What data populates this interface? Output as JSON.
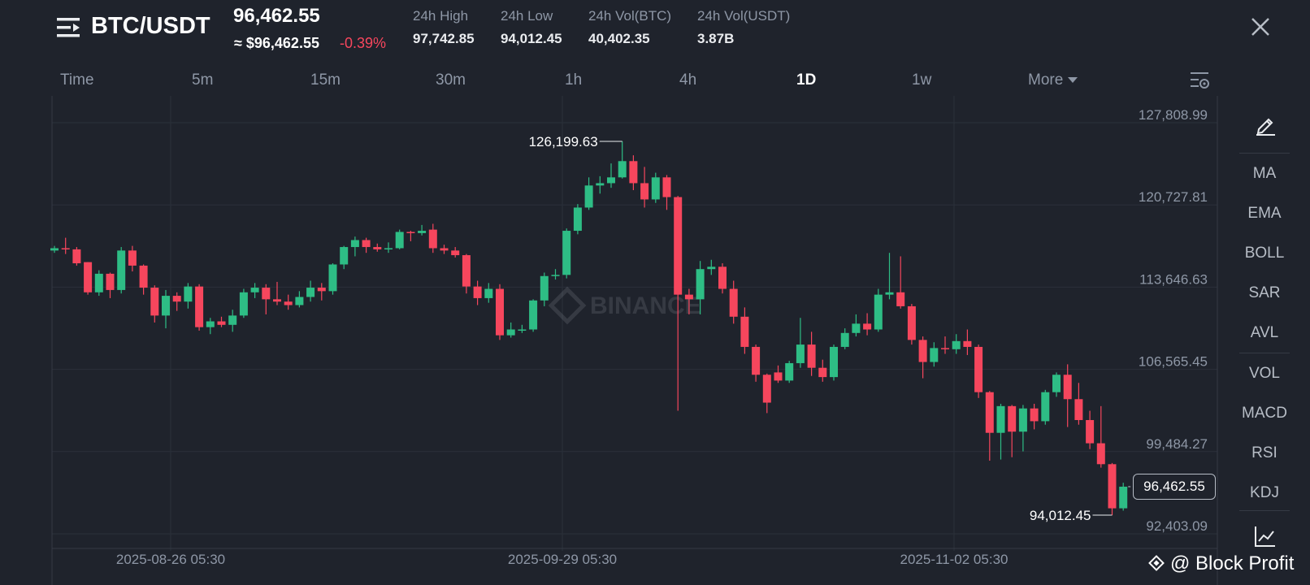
{
  "header": {
    "pair": "BTC/USDT",
    "last_price": "96,462.55",
    "approx_usd": "≈ $96,462.55",
    "change_pct": "-0.39%",
    "stats": [
      {
        "label": "24h High",
        "value": "97,742.85"
      },
      {
        "label": "24h Low",
        "value": "94,012.45"
      },
      {
        "label": "24h Vol(BTC)",
        "value": "40,402.35"
      },
      {
        "label": "24h Vol(USDT)",
        "value": "3.87B"
      }
    ]
  },
  "intervals": [
    "Time",
    "5m",
    "15m",
    "30m",
    "1h",
    "4h",
    "1D",
    "1w"
  ],
  "active_interval": "1D",
  "more_label": "More",
  "indicators": [
    "MA",
    "EMA",
    "BOLL",
    "SAR",
    "AVL",
    "VOL",
    "MACD",
    "RSI",
    "KDJ"
  ],
  "watermark": "BINANCE",
  "attribution": "@ Block Profit",
  "colors": {
    "up": "#2ebd85",
    "down": "#f6465d",
    "bg": "#1f232c",
    "grid": "#2b303a",
    "text_muted": "#8e97a6"
  },
  "chart_data": {
    "type": "candlestick",
    "price_axis_labels": [
      "127,808.99",
      "120,727.81",
      "113,646.63",
      "106,565.45",
      "99,484.27",
      "92,403.09"
    ],
    "price_axis_values": [
      127808.99,
      120727.81,
      113646.63,
      106565.45,
      99484.27,
      92403.09
    ],
    "date_labels": [
      "2025-08-26 05:30",
      "2025-09-29 05:30",
      "2025-11-02 05:30"
    ],
    "high_marker": {
      "label": "126,199.63",
      "value": 126199.63
    },
    "low_marker": {
      "label": "94,012.45",
      "value": 94012.45
    },
    "last_price_label": "96,462.55",
    "last_price_value": 96462.55,
    "candles": [
      [
        116800,
        117000,
        117200,
        116600
      ],
      [
        117000,
        116900,
        117900,
        116500
      ],
      [
        116900,
        115700,
        117100,
        115500
      ],
      [
        115800,
        113200,
        115800,
        113000
      ],
      [
        113200,
        114800,
        115100,
        112900
      ],
      [
        114800,
        113400,
        114900,
        112700
      ],
      [
        113400,
        116800,
        117100,
        113100
      ],
      [
        116800,
        115500,
        117200,
        115000
      ],
      [
        115500,
        113600,
        115600,
        113000
      ],
      [
        113600,
        111200,
        113800,
        110600
      ],
      [
        111200,
        112900,
        113400,
        110100
      ],
      [
        112900,
        112400,
        113200,
        111600
      ],
      [
        112400,
        113700,
        114000,
        111800
      ],
      [
        113700,
        110200,
        113900,
        109900
      ],
      [
        110200,
        110700,
        111000,
        109600
      ],
      [
        110700,
        110400,
        111100,
        110200
      ],
      [
        110400,
        111200,
        111700,
        109800
      ],
      [
        111200,
        113200,
        113500,
        111000
      ],
      [
        113200,
        113600,
        114000,
        112700
      ],
      [
        113600,
        112600,
        113900,
        111300
      ],
      [
        112600,
        112400,
        114100,
        112100
      ],
      [
        112400,
        112100,
        113000,
        111700
      ],
      [
        112100,
        112800,
        113300,
        111900
      ],
      [
        112800,
        113600,
        114200,
        112400
      ],
      [
        113600,
        113300,
        114000,
        112500
      ],
      [
        113300,
        115600,
        115700,
        113000
      ],
      [
        115600,
        117100,
        117200,
        115200
      ],
      [
        117100,
        117700,
        118000,
        116300
      ],
      [
        117700,
        117100,
        117900,
        116600
      ],
      [
        117100,
        116900,
        117400,
        116700
      ],
      [
        116900,
        117000,
        117500,
        116600
      ],
      [
        117000,
        118400,
        118600,
        116900
      ],
      [
        118400,
        118300,
        118500,
        117600
      ],
      [
        118300,
        118500,
        119000,
        118100
      ],
      [
        118600,
        117000,
        119100,
        116600
      ],
      [
        117000,
        116800,
        117300,
        116500
      ],
      [
        116800,
        116400,
        117100,
        116200
      ],
      [
        116400,
        113700,
        116500,
        113100
      ],
      [
        113700,
        112700,
        114200,
        112100
      ],
      [
        112700,
        113500,
        114000,
        112300
      ],
      [
        113500,
        109500,
        113900,
        109100
      ],
      [
        109500,
        110000,
        110600,
        109300
      ],
      [
        110000,
        110000,
        110400,
        109700
      ],
      [
        110000,
        112500,
        112600,
        109800
      ],
      [
        112500,
        114600,
        114900,
        112000
      ],
      [
        114600,
        114700,
        115200,
        114300
      ],
      [
        114700,
        118500,
        118700,
        114400
      ],
      [
        118500,
        120500,
        120800,
        118200
      ],
      [
        120500,
        122400,
        123100,
        120300
      ],
      [
        122400,
        122600,
        123200,
        121700
      ],
      [
        122600,
        123100,
        124300,
        122200
      ],
      [
        123100,
        124500,
        126199.63,
        123000
      ],
      [
        124500,
        122600,
        125000,
        122000
      ],
      [
        122600,
        121200,
        124000,
        120500
      ],
      [
        121200,
        123100,
        123500,
        120900
      ],
      [
        123100,
        121400,
        123300,
        120300
      ],
      [
        121400,
        113000,
        121500,
        103000
      ],
      [
        113000,
        112600,
        113500,
        111300
      ],
      [
        112600,
        115200,
        115900,
        111300
      ],
      [
        115200,
        115400,
        116000,
        114700
      ],
      [
        115400,
        113500,
        115700,
        113100
      ],
      [
        113500,
        111100,
        114200,
        110500
      ],
      [
        111100,
        108500,
        111900,
        107900
      ],
      [
        108500,
        106100,
        108700,
        105500
      ],
      [
        106100,
        103700,
        106200,
        102800
      ],
      [
        106300,
        105600,
        106900,
        105400
      ],
      [
        105600,
        107100,
        107300,
        105400
      ],
      [
        107100,
        108700,
        111000,
        106700
      ],
      [
        108700,
        106700,
        109800,
        106000
      ],
      [
        106700,
        105900,
        107400,
        105500
      ],
      [
        105900,
        108500,
        108700,
        105600
      ],
      [
        108500,
        109700,
        110100,
        108300
      ],
      [
        109700,
        110500,
        111300,
        109400
      ],
      [
        110500,
        110000,
        111400,
        109500
      ],
      [
        110000,
        113000,
        113500,
        109800
      ],
      [
        113000,
        113200,
        116600,
        112600
      ],
      [
        113200,
        112000,
        116300,
        111800
      ],
      [
        112000,
        109100,
        112200,
        108700
      ],
      [
        109100,
        107200,
        109400,
        105800
      ],
      [
        107200,
        108400,
        108900,
        106800
      ],
      [
        108400,
        108300,
        109400,
        107900
      ],
      [
        108300,
        109000,
        109600,
        107900
      ],
      [
        109000,
        108500,
        110000,
        107800
      ],
      [
        108500,
        104600,
        108700,
        104100
      ],
      [
        104600,
        101100,
        104700,
        98700
      ],
      [
        101100,
        103400,
        103600,
        98800
      ],
      [
        103400,
        101200,
        103500,
        99000
      ],
      [
        101200,
        103200,
        103500,
        99500
      ],
      [
        103200,
        102100,
        103600,
        101400
      ],
      [
        102100,
        104600,
        104800,
        101800
      ],
      [
        104600,
        106100,
        106300,
        104200
      ],
      [
        106100,
        104000,
        107000,
        101600
      ],
      [
        104000,
        102200,
        105400,
        101800
      ],
      [
        102200,
        100200,
        103000,
        99700
      ],
      [
        100200,
        98400,
        103400,
        98100
      ],
      [
        98400,
        94600,
        98500,
        94012.45
      ],
      [
        94600,
        96462.55,
        96800,
        94400
      ]
    ]
  }
}
